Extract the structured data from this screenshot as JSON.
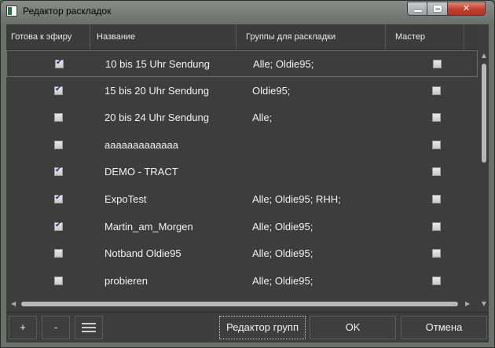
{
  "window": {
    "title": "Редактор раскладок"
  },
  "columns": {
    "ready": "Готова к эфиру",
    "name": "Название",
    "groups": "Группы для раскладки",
    "master": "Мастер"
  },
  "rows": [
    {
      "ready": true,
      "name": "10 bis 15 Uhr Sendung",
      "groups": "Alle; Oldie95;",
      "master": false
    },
    {
      "ready": true,
      "name": "15 bis 20 Uhr Sendung",
      "groups": "Oldie95;",
      "master": false
    },
    {
      "ready": false,
      "name": "20 bis 24 Uhr Sendung",
      "groups": "Alle;",
      "master": false
    },
    {
      "ready": false,
      "name": "aaaaaaaaaaaaa",
      "groups": "",
      "master": false
    },
    {
      "ready": true,
      "name": "DEMO - TRACT",
      "groups": "",
      "master": false
    },
    {
      "ready": true,
      "name": "ExpoTest",
      "groups": "Alle; Oldie95; RHH;",
      "master": false
    },
    {
      "ready": true,
      "name": "Martin_am_Morgen",
      "groups": "Alle; Oldie95;",
      "master": false
    },
    {
      "ready": false,
      "name": "Notband Oldie95",
      "groups": "Alle; Oldie95;",
      "master": false
    },
    {
      "ready": false,
      "name": "probieren",
      "groups": "Alle; Oldie95;",
      "master": false
    }
  ],
  "footer": {
    "add_label": "+",
    "remove_label": "-",
    "menu_icon": "hamburger-icon",
    "group_editor_label": "Редактор групп",
    "ok_label": "OK",
    "cancel_label": "Отмена"
  },
  "colors": {
    "background": "#3d3d3d",
    "text": "#f2f2f2",
    "check": "#1b2b7e",
    "close_button": "#c4402d"
  }
}
